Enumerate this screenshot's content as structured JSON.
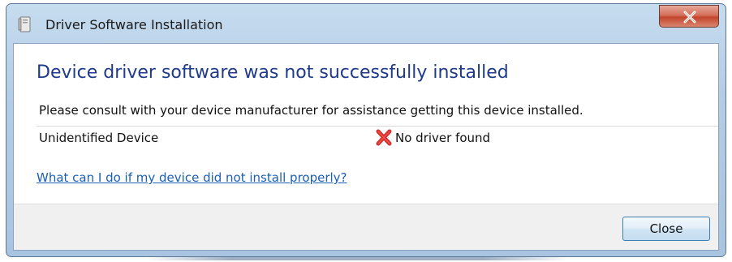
{
  "window": {
    "title": "Driver Software Installation",
    "title_icon": "driver-installation-icon",
    "close_icon": "close-x-icon"
  },
  "content": {
    "heading": "Device driver software was not successfully installed",
    "instruction": "Please consult with your device manufacturer for assistance getting this device installed.",
    "devices": [
      {
        "name": "Unidentified Device",
        "status_icon": "error-x-icon",
        "status": "No driver found"
      }
    ],
    "help_link": "What can I do if my device did not install properly?"
  },
  "footer": {
    "close_label": "Close"
  },
  "colors": {
    "heading": "#1e3a8a",
    "link": "#1a5fb4",
    "error": "#d32f2f"
  }
}
